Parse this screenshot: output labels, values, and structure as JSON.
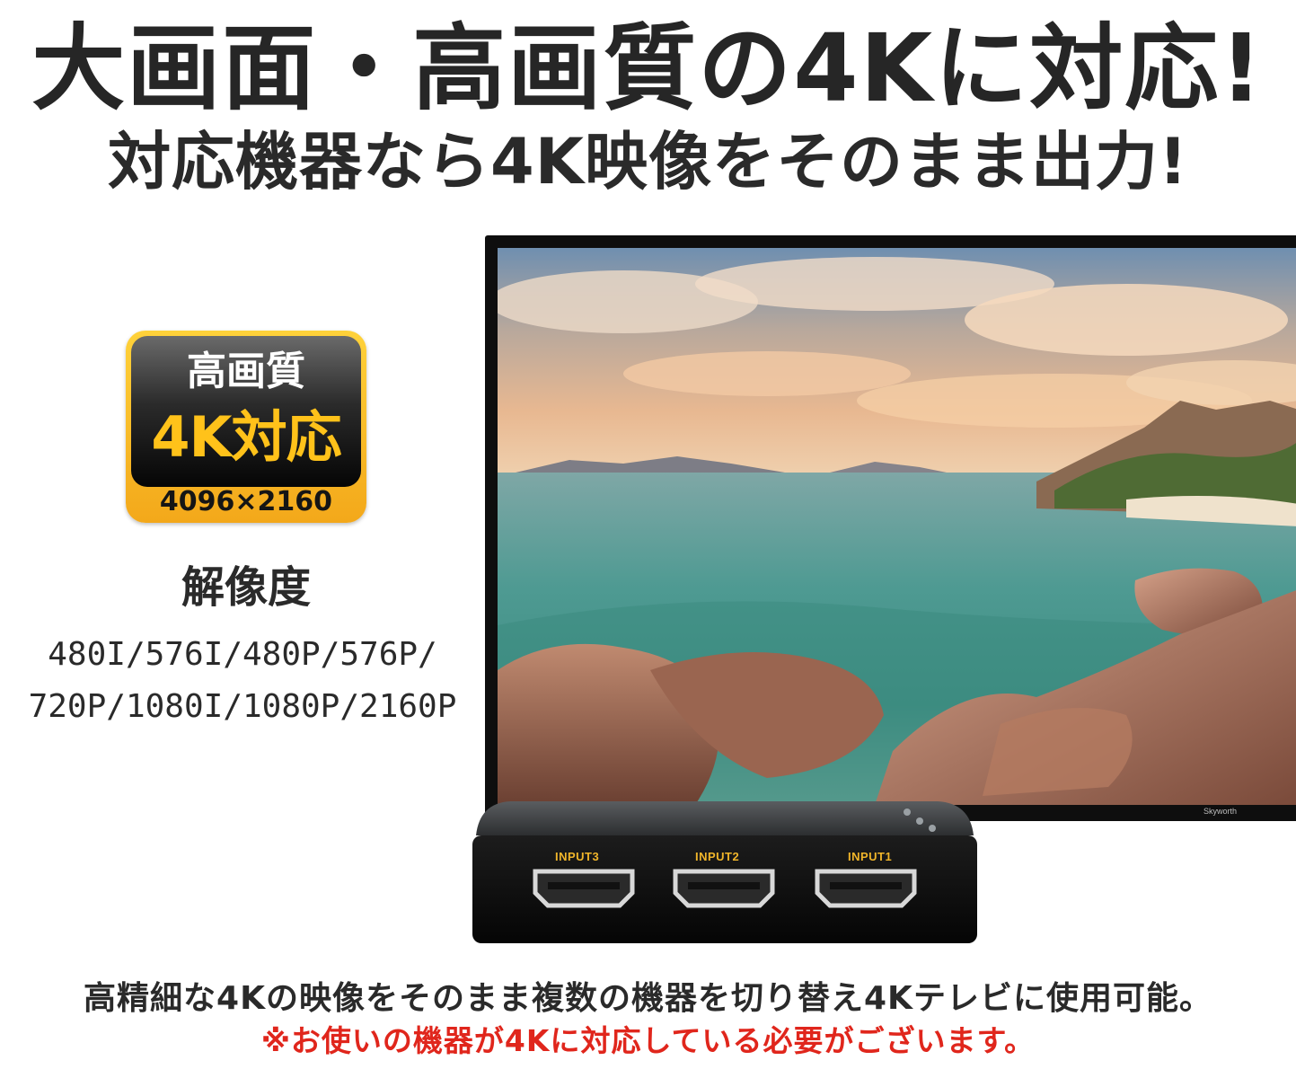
{
  "headline": "大画面・高画質の4Kに対応!",
  "subheadline": "対応機器なら4K映像をそのまま出力!",
  "badge": {
    "top": "高画質",
    "main": "4K対応",
    "resolution": "4096×2160"
  },
  "resolution_label": "解像度",
  "resolution_list": [
    "480I/576I/480P/576P/",
    "720P/1080I/1080P/2160P"
  ],
  "tv_brand": "Skyworth",
  "device_inputs": [
    "INPUT3",
    "INPUT2",
    "INPUT1"
  ],
  "caption": "高精細な4Kの映像をそのまま複数の機器を切り替え4Kテレビに使用可能。",
  "note": "※お使いの機器が4Kに対応している必要がございます。",
  "colors": {
    "badge_gold": "#f5b01e",
    "badge_text_gold": "#ffc21a",
    "note_red": "#e0261c",
    "input_label": "#f0b52a"
  }
}
